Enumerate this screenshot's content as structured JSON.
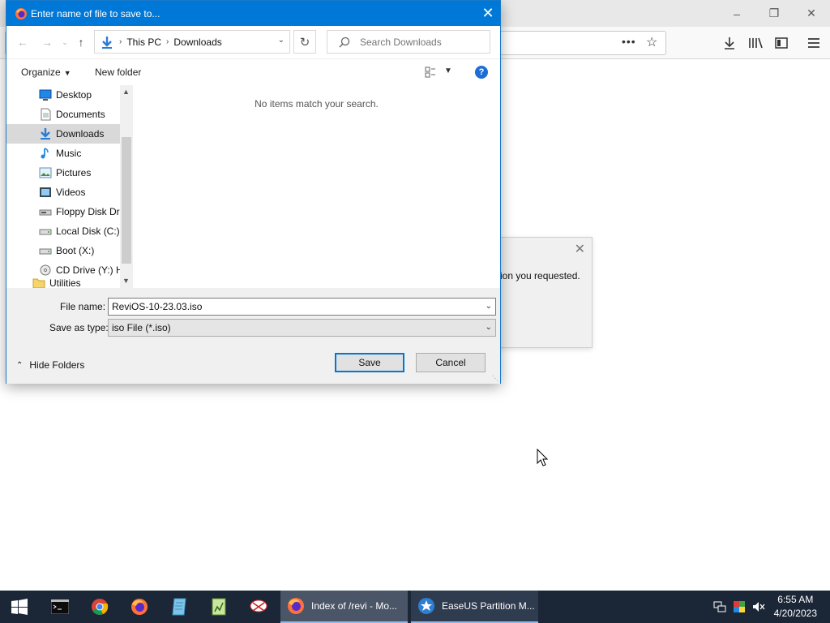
{
  "dialog": {
    "title": "Enter name of file to save to...",
    "address": {
      "root": "This PC",
      "current": "Downloads"
    },
    "search_placeholder": "Search Downloads",
    "commands": {
      "organize": "Organize",
      "new_folder": "New folder"
    },
    "tree": [
      {
        "label": "Desktop",
        "icon": "desktop-icon"
      },
      {
        "label": "Documents",
        "icon": "documents-icon"
      },
      {
        "label": "Downloads",
        "icon": "downloads-icon",
        "selected": true
      },
      {
        "label": "Music",
        "icon": "music-icon"
      },
      {
        "label": "Pictures",
        "icon": "pictures-icon"
      },
      {
        "label": "Videos",
        "icon": "videos-icon"
      },
      {
        "label": "Floppy Disk Dri",
        "icon": "floppy-drive-icon"
      },
      {
        "label": "Local Disk (C:)",
        "icon": "drive-icon"
      },
      {
        "label": "Boot (X:)",
        "icon": "drive-icon"
      },
      {
        "label": "CD Drive (Y:) H",
        "icon": "cd-drive-icon"
      },
      {
        "label": "Utilities",
        "icon": "folder-icon"
      }
    ],
    "empty_message": "No items match your search.",
    "file_name_label": "File name:",
    "file_name_value": "ReviOS-10-23.03.iso",
    "save_type_label": "Save as type:",
    "save_type_value": "iso File (*.iso)",
    "hide_folders": "Hide Folders",
    "save_button": "Save",
    "cancel_button": "Cancel"
  },
  "background_dialog": {
    "message_fragment": "ion you requested."
  },
  "taskbar": {
    "pinned": [
      "cmd-icon",
      "chrome-icon",
      "firefox-icon",
      "notepad-icon",
      "notepadpp-icon",
      "snipping-tool-icon"
    ],
    "tasks": [
      {
        "label": "Index of /revi - Mo...",
        "icon": "firefox-icon",
        "state": "active"
      },
      {
        "label": "EaseUS Partition M...",
        "icon": "easeus-icon",
        "state": "open"
      }
    ],
    "time": "6:55 AM",
    "date": "4/20/2023"
  },
  "colors": {
    "titlebar": "#0078d7",
    "taskbar": "#1b2637"
  }
}
